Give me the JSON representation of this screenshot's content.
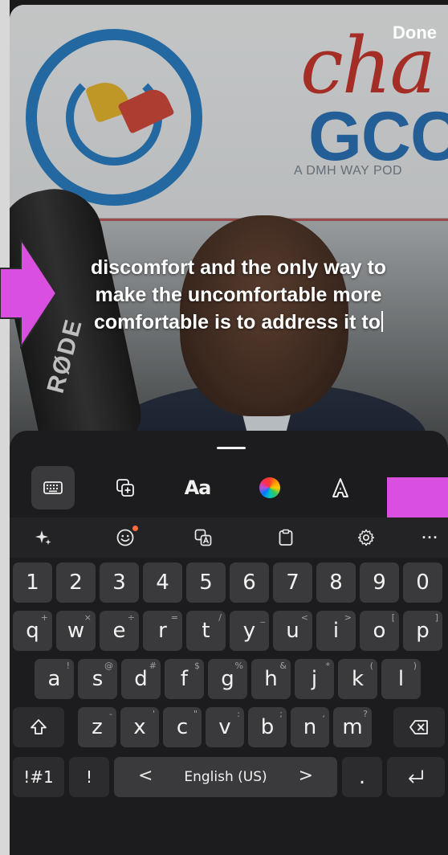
{
  "header": {
    "done_label": "Done"
  },
  "video": {
    "brand_cha": "cha",
    "brand_gcc": "GCC",
    "brand_sub": "A DMH WAY POD",
    "mic_text": "RØDE"
  },
  "caption": {
    "line1": "discomfort and the only way to",
    "line2": "make the uncomfortable more",
    "line3": "comfortable is to address it to"
  },
  "toolbar": {
    "items": [
      {
        "icon": "keyboard-icon"
      },
      {
        "icon": "add-sticker-icon"
      },
      {
        "icon": "font-icon",
        "label": "Aa"
      },
      {
        "icon": "color-wheel-icon"
      },
      {
        "icon": "text-style-icon"
      }
    ]
  },
  "suggestions": {
    "items": [
      "sparkle-icon",
      "emoji-icon",
      "translate-icon",
      "clipboard-icon",
      "settings-icon"
    ],
    "more_label": "···"
  },
  "keyboard": {
    "numbers": [
      "1",
      "2",
      "3",
      "4",
      "5",
      "6",
      "7",
      "8",
      "9",
      "0"
    ],
    "row1": [
      {
        "k": "q",
        "h": "+"
      },
      {
        "k": "w",
        "h": "×"
      },
      {
        "k": "e",
        "h": "÷"
      },
      {
        "k": "r",
        "h": "="
      },
      {
        "k": "t",
        "h": "/"
      },
      {
        "k": "y",
        "h": "_"
      },
      {
        "k": "u",
        "h": "<"
      },
      {
        "k": "i",
        "h": ">"
      },
      {
        "k": "o",
        "h": "["
      },
      {
        "k": "p",
        "h": "]"
      }
    ],
    "row2": [
      {
        "k": "a",
        "h": "!"
      },
      {
        "k": "s",
        "h": "@"
      },
      {
        "k": "d",
        "h": "#"
      },
      {
        "k": "f",
        "h": "$"
      },
      {
        "k": "g",
        "h": "%"
      },
      {
        "k": "h",
        "h": "&"
      },
      {
        "k": "j",
        "h": "*"
      },
      {
        "k": "k",
        "h": "("
      },
      {
        "k": "l",
        "h": ")"
      }
    ],
    "row3": [
      {
        "k": "z",
        "h": "-"
      },
      {
        "k": "x",
        "h": "'"
      },
      {
        "k": "c",
        "h": "\""
      },
      {
        "k": "v",
        "h": ":"
      },
      {
        "k": "b",
        "h": ";"
      },
      {
        "k": "n",
        "h": ","
      },
      {
        "k": "m",
        "h": "?"
      }
    ],
    "symbols_label": "!#1",
    "exclaim_label": "!",
    "space_label": "English (US)",
    "left_chevron": "<",
    "right_chevron": ">",
    "period_label": "."
  },
  "colors": {
    "annotation": "#d94fe0",
    "sheet": "#1c1c1e",
    "key": "#3a3a3c"
  }
}
